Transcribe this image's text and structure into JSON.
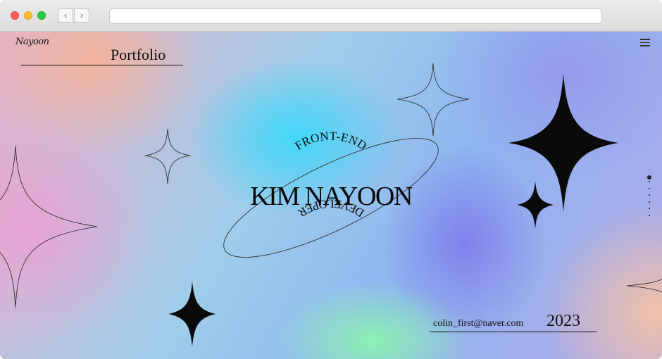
{
  "browser": {
    "back_icon": "chevron-left-icon",
    "forward_icon": "chevron-right-icon",
    "url": ""
  },
  "header": {
    "logo_text": "Nayoon",
    "title": "Portfolio",
    "menu_icon": "hamburger-menu-icon"
  },
  "hero": {
    "name": "KIM NAYOON",
    "arc_top": "FRONT-END",
    "arc_bottom": "DEVELOPER"
  },
  "side_nav": {
    "dot_count": 7,
    "active_index": 0
  },
  "footer": {
    "email": "colin_first@naver.com",
    "year": "2023"
  },
  "colors": {
    "text": "#111111",
    "cyan": "#3cd7fa",
    "green": "#8cf5af",
    "purple": "#7d78eb",
    "peach": "#f5c3a5",
    "pink": "#eba0d2"
  }
}
